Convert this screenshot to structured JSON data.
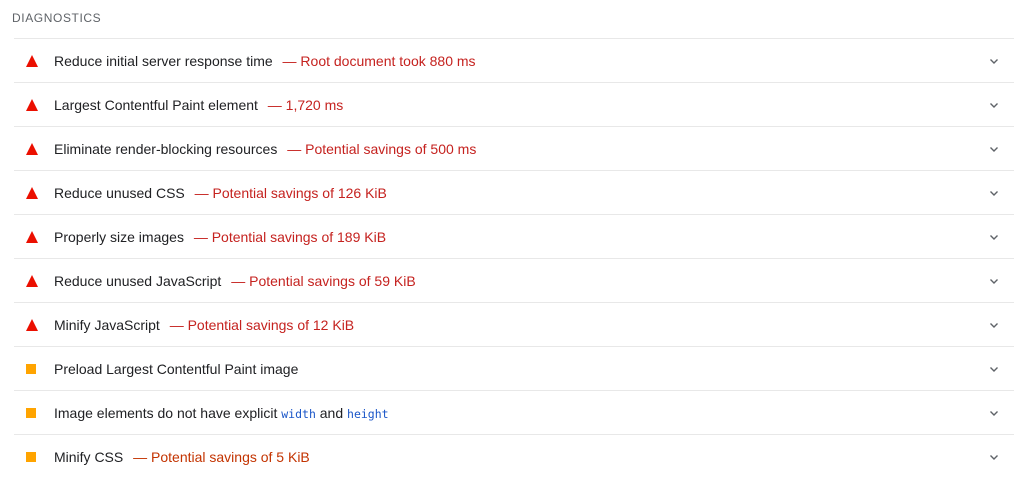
{
  "section": {
    "title": "DIAGNOSTICS"
  },
  "colors": {
    "fail": "#eb0f00",
    "average": "#ffa400",
    "fail_text": "#c5221f",
    "average_text": "#c33300",
    "code_text": "#1a56c8"
  },
  "audits": [
    {
      "severity": "fail",
      "icon": "triangle-warning-icon",
      "title": "Reduce initial server response time",
      "detail": "— Root document took 880 ms"
    },
    {
      "severity": "fail",
      "icon": "triangle-warning-icon",
      "title": "Largest Contentful Paint element",
      "detail": "— 1,720 ms"
    },
    {
      "severity": "fail",
      "icon": "triangle-warning-icon",
      "title": "Eliminate render-blocking resources",
      "detail": "— Potential savings of 500 ms"
    },
    {
      "severity": "fail",
      "icon": "triangle-warning-icon",
      "title": "Reduce unused CSS",
      "detail": "— Potential savings of 126 KiB"
    },
    {
      "severity": "fail",
      "icon": "triangle-warning-icon",
      "title": "Properly size images",
      "detail": "— Potential savings of 189 KiB"
    },
    {
      "severity": "fail",
      "icon": "triangle-warning-icon",
      "title": "Reduce unused JavaScript",
      "detail": "— Potential savings of 59 KiB"
    },
    {
      "severity": "fail",
      "icon": "triangle-warning-icon",
      "title": "Minify JavaScript",
      "detail": "— Potential savings of 12 KiB"
    },
    {
      "severity": "average",
      "icon": "square-warning-icon",
      "title": "Preload Largest Contentful Paint image",
      "detail": ""
    },
    {
      "severity": "average",
      "icon": "square-warning-icon",
      "title_prefix": "Image elements do not have explicit",
      "code1": "width",
      "mid": "and",
      "code2": "height",
      "detail": ""
    },
    {
      "severity": "average",
      "icon": "square-warning-icon",
      "title": "Minify CSS",
      "detail": "— Potential savings of 5 KiB"
    }
  ],
  "expand_icon": "chevron-down-icon"
}
